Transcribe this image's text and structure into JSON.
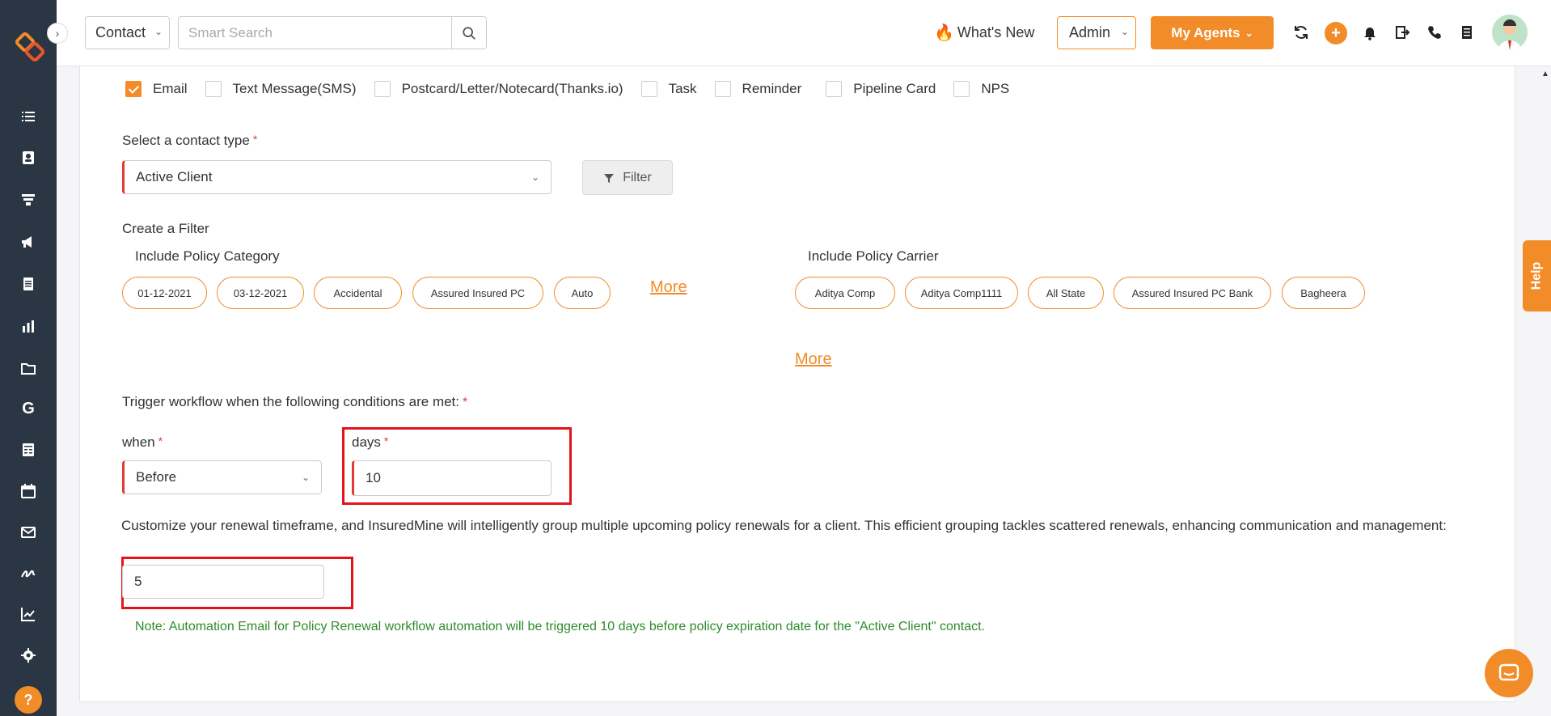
{
  "topbar": {
    "contact_select": "Contact",
    "search_placeholder": "Smart Search",
    "whats_new": "What's New",
    "admin_select": "Admin",
    "agents_button": "My Agents"
  },
  "channels": [
    {
      "label": "Email",
      "checked": true
    },
    {
      "label": "Text Message(SMS)",
      "checked": false
    },
    {
      "label": "Postcard/Letter/Notecard(Thanks.io)",
      "checked": false
    },
    {
      "label": "Task",
      "checked": false
    },
    {
      "label": "Reminder",
      "checked": false
    },
    {
      "label": "Pipeline Card",
      "checked": false
    },
    {
      "label": "NPS",
      "checked": false
    }
  ],
  "contact_type": {
    "label": "Select a contact type",
    "required": "*",
    "value": "Active Client",
    "filter_button": "Filter"
  },
  "filter": {
    "title": "Create a Filter",
    "policy_category": {
      "label": "Include Policy Category",
      "pills": [
        "01-12-2021",
        "03-12-2021",
        "Accidental",
        "Assured Insured PC",
        "Auto"
      ],
      "more": "More"
    },
    "policy_carrier": {
      "label": "Include Policy Carrier",
      "pills": [
        "Aditya Comp",
        "Aditya Comp1111",
        "All State",
        "Assured Insured PC Bank",
        "Bagheera"
      ],
      "more": "More"
    }
  },
  "trigger": {
    "label": "Trigger workflow when the following conditions are met:",
    "required": "*",
    "when_label": "when",
    "when_value": "Before",
    "days_label": "days",
    "days_value": "10"
  },
  "renewal": {
    "description": "Customize your renewal timeframe, and InsuredMine will intelligently group multiple upcoming policy renewals for a client. This efficient grouping tackles scattered renewals, enhancing communication and management:",
    "value": "5"
  },
  "note": "Note: Automation Email for Policy Renewal workflow automation will be triggered 10 days before policy expiration date for the \"Active Client\" contact.",
  "help_tab": "Help",
  "colors": {
    "accent": "#f28c28",
    "sidebar": "#2a3643",
    "required": "#e53935",
    "note": "#2e8b2e",
    "highlight": "#e3141b"
  }
}
